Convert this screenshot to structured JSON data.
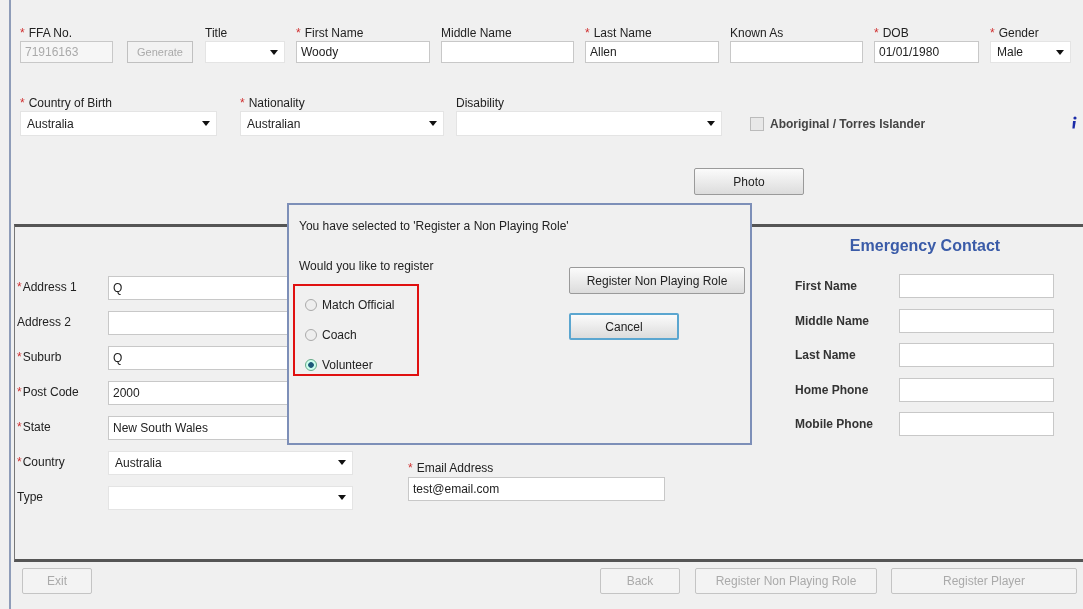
{
  "top_row": [
    {
      "mark": "*",
      "label": "FFA No.",
      "kind": "ffa",
      "value": "71916163",
      "disabled": true,
      "button": {
        "label": "Generate",
        "disabled": true
      }
    },
    {
      "label": "Title",
      "kind": "select"
    },
    {
      "mark": "*",
      "label": "First Name",
      "kind": "text",
      "value": "Woody"
    },
    {
      "label": "Middle Name",
      "kind": "text"
    },
    {
      "mark": "*",
      "label": "Last Name",
      "kind": "text",
      "value": "Allen"
    },
    {
      "label": "Known As",
      "kind": "text"
    },
    {
      "mark": "*",
      "label": "DOB",
      "kind": "text",
      "value": "01/01/1980"
    },
    {
      "mark": "*",
      "label": "Gender",
      "kind": "select",
      "value": "Male"
    }
  ],
  "second_row": [
    {
      "mark": "*",
      "label": "Country of Birth",
      "kind": "select",
      "value": "Australia"
    },
    {
      "mark": "*",
      "label": "Nationality",
      "kind": "select",
      "value": "Australian"
    },
    {
      "label": "Disability",
      "kind": "select"
    }
  ],
  "aboriginal_checkbox": {
    "label": "Aboriginal / Torres Islander",
    "checked": false
  },
  "photo_button": {
    "label": "Photo"
  },
  "address": [
    {
      "mark": "*",
      "label": "Address 1",
      "kind": "text",
      "value": "Q"
    },
    {
      "label": "Address 2",
      "kind": "text"
    },
    {
      "mark": "*",
      "label": "Suburb",
      "kind": "text",
      "value": "Q"
    },
    {
      "mark": "*",
      "label": "Post Code",
      "kind": "text",
      "value": "2000"
    },
    {
      "mark": "*",
      "label": "State",
      "kind": "text",
      "value": "New South Wales"
    },
    {
      "mark": "*",
      "label": "Country",
      "kind": "select",
      "value": "Australia"
    },
    {
      "label": "Type",
      "kind": "select"
    }
  ],
  "email": {
    "mark": "*",
    "label": "Email Address",
    "value": "test@email.com"
  },
  "emergency_contact": {
    "title": "Emergency Contact",
    "fields": [
      {
        "label": "First Name"
      },
      {
        "label": "Middle Name"
      },
      {
        "label": "Last Name"
      },
      {
        "label": "Home Phone"
      },
      {
        "label": "Mobile Phone"
      }
    ]
  },
  "dialog": {
    "message": "You have selected to 'Register a Non Playing Role'",
    "question": "Would you like to register",
    "options_highlighted": true,
    "options": [
      {
        "label": "Match Official",
        "selected": false
      },
      {
        "label": "Coach",
        "selected": false
      },
      {
        "label": "Volunteer",
        "selected": true
      }
    ],
    "buttons": [
      {
        "label": "Register Non Playing Role",
        "focused": false
      },
      {
        "label": "Cancel",
        "focused": true
      }
    ]
  },
  "bottom_buttons": [
    {
      "label": "Exit",
      "disabled": true
    },
    {
      "label": "Back",
      "disabled": true
    },
    {
      "label": "Register Non Playing Role",
      "disabled": true
    },
    {
      "label": "Register Player",
      "disabled": true
    }
  ]
}
